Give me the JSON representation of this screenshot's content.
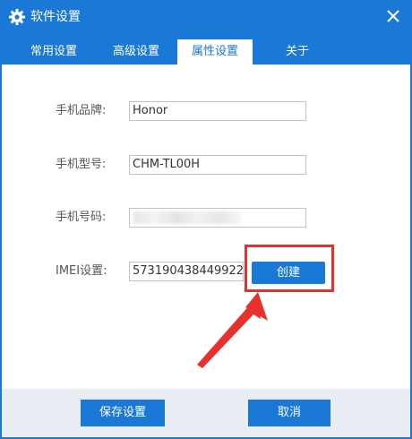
{
  "window": {
    "title": "软件设置",
    "title_icon": "gear-icon",
    "close_icon": "close-icon"
  },
  "tabs": [
    {
      "label": "常用设置",
      "active": false
    },
    {
      "label": "高级设置",
      "active": false
    },
    {
      "label": "属性设置",
      "active": true
    },
    {
      "label": "关于",
      "active": false
    }
  ],
  "form": {
    "brand_label": "手机品牌:",
    "brand_value": "Honor",
    "model_label": "手机型号:",
    "model_value": "CHM-TL00H",
    "phone_label": "手机号码:",
    "phone_value": "",
    "imei_label": "IMEI设置:",
    "imei_value": "573190438449922",
    "create_label": "创建"
  },
  "footer": {
    "save_label": "保存设置",
    "cancel_label": "取消"
  },
  "colors": {
    "accent": "#1a78d6",
    "annotation": "#e8312c",
    "footer_bg": "#e9eef4"
  }
}
